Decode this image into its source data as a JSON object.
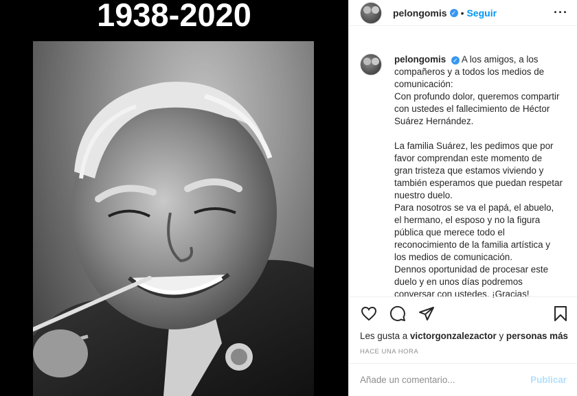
{
  "media": {
    "title": "1938-2020"
  },
  "header": {
    "username": "pelongomis",
    "verified_glyph": "✓",
    "separator": "•",
    "follow_label": "Seguir",
    "more_glyph": "···"
  },
  "caption": {
    "username": "pelongomis",
    "text": "A los amigos, a los compañeros y a todos los medios de comunicación:\nCon profundo dolor, queremos compartir con ustedes el fallecimiento de Héctor Suárez Hernández.\n\nLa familia Suárez, les pedimos que por favor comprendan este momento de gran tristeza que estamos viviendo y también esperamos que puedan respetar nuestro duelo.\nPara nosotros se va el papá, el abuelo, el hermano, el esposo y no la figura pública que merece todo el reconocimiento de la familia artística y los medios de comunicación.\nDennos oportunidad de procesar este duelo y en unos días podremos conversar con ustedes. ¡Gracias!"
  },
  "actions": {
    "icons": [
      "heart-icon",
      "comment-icon",
      "share-icon",
      "bookmark-icon"
    ]
  },
  "likes": {
    "prefix": "Les gusta a",
    "user": "victorgonzalezactor",
    "middle": "y",
    "others": "personas más"
  },
  "timestamp": "Hace una hora",
  "comment": {
    "placeholder": "Añade un comentario...",
    "publish_label": "Publicar"
  },
  "colors": {
    "accent": "#0095f6",
    "verified": "#3897f0",
    "publish_disabled": "#b2dffc",
    "muted": "#8e8e8e"
  }
}
